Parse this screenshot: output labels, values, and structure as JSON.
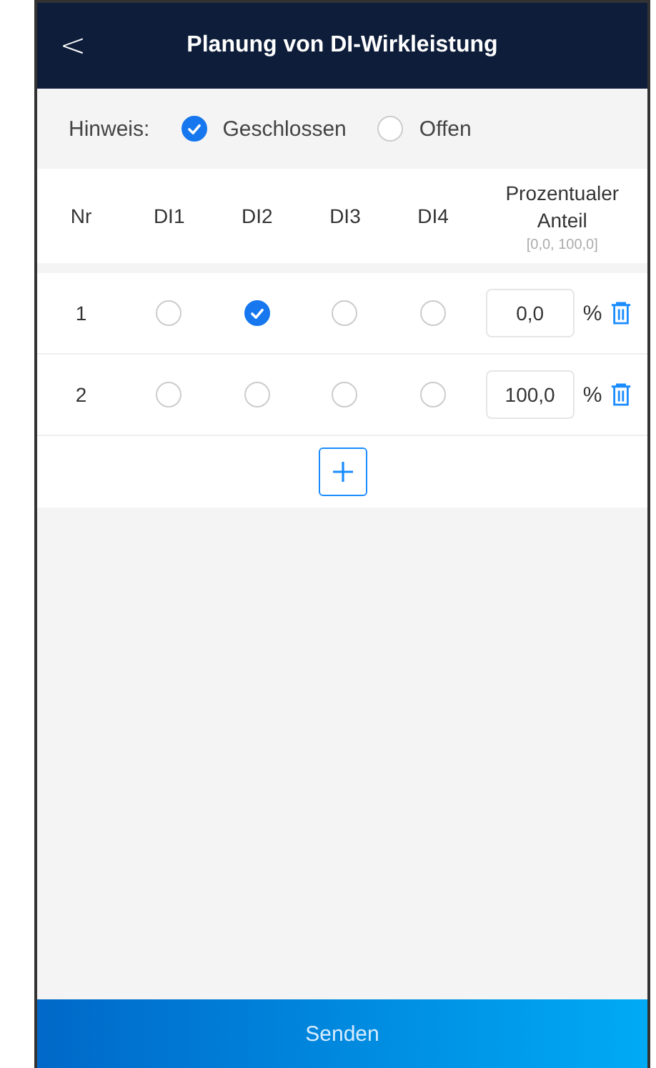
{
  "header": {
    "back": "<",
    "title": "Planung von DI-Wirkleistung"
  },
  "hint": {
    "label": "Hinweis:",
    "options": [
      {
        "label": "Geschlossen",
        "selected": true
      },
      {
        "label": "Offen",
        "selected": false
      }
    ]
  },
  "table": {
    "columns": [
      "Nr",
      "DI1",
      "DI2",
      "DI3",
      "DI4"
    ],
    "percent_column": {
      "label": "Prozentualer Anteil",
      "range": "[0,0, 100,0]"
    },
    "rows": [
      {
        "nr": "1",
        "di": [
          {
            "selected": false
          },
          {
            "selected": true
          },
          {
            "selected": false
          },
          {
            "selected": false
          }
        ],
        "value": "0,0",
        "unit": "%"
      },
      {
        "nr": "2",
        "di": [
          {
            "selected": false
          },
          {
            "selected": false
          },
          {
            "selected": false
          },
          {
            "selected": false
          }
        ],
        "value": "100,0",
        "unit": "%"
      }
    ]
  },
  "submit": "Senden"
}
